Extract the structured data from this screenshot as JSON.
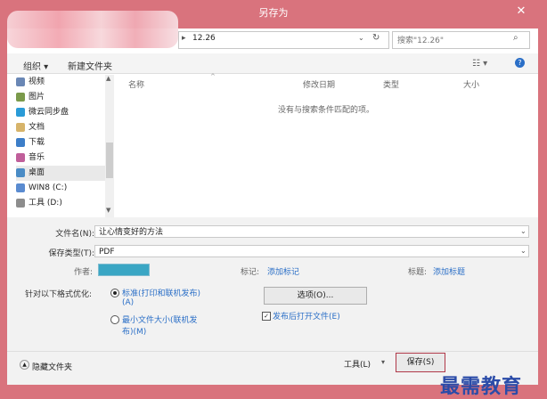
{
  "window": {
    "title": "另存为",
    "close_glyph": "✕"
  },
  "address": {
    "path": "12.26",
    "search_placeholder": "搜索\"12.26\""
  },
  "toolbar": {
    "organize": "组织 ▾",
    "new_folder": "新建文件夹"
  },
  "nav": [
    {
      "label": "视频",
      "icon": "video-icon",
      "color": "#6a87b5"
    },
    {
      "label": "图片",
      "icon": "picture-icon",
      "color": "#7b9a4b"
    },
    {
      "label": "微云同步盘",
      "icon": "cloud-icon",
      "color": "#2a9bd7"
    },
    {
      "label": "文档",
      "icon": "document-icon",
      "color": "#d7b46a"
    },
    {
      "label": "下载",
      "icon": "download-icon",
      "color": "#3d7ec8"
    },
    {
      "label": "音乐",
      "icon": "music-icon",
      "color": "#c05f9a"
    },
    {
      "label": "桌面",
      "icon": "desktop-icon",
      "color": "#4a8bc5"
    },
    {
      "label": "WIN8 (C:)",
      "icon": "drive-icon",
      "color": "#5a8bd0"
    },
    {
      "label": "工具 (D:)",
      "icon": "drive-icon",
      "color": "#8d8d8d"
    }
  ],
  "columns": {
    "name": "名称",
    "modified": "修改日期",
    "type": "类型",
    "size": "大小"
  },
  "empty_message": "没有与搜索条件匹配的项。",
  "form": {
    "filename_label": "文件名(N):",
    "filename_value": "让心情变好的方法",
    "filetype_label": "保存类型(T):",
    "filetype_value": "PDF",
    "author_label": "作者:",
    "tags_label": "标记:",
    "tags_link": "添加标记",
    "title_label": "标题:",
    "title_link": "添加标题",
    "optimize_label": "针对以下格式优化:",
    "radio1_line1": "标准(打印和联机发布)",
    "radio1_line2": "(A)",
    "radio2_line1": "最小文件大小(联机发",
    "radio2_line2": "布)(M)",
    "options_button": "选项(O)...",
    "open_after_label": "发布后打开文件(E)"
  },
  "bottom": {
    "hide_folders": "隐藏文件夹",
    "tools": "工具(L)",
    "save": "保存(S)"
  },
  "watermark": "最需教育"
}
